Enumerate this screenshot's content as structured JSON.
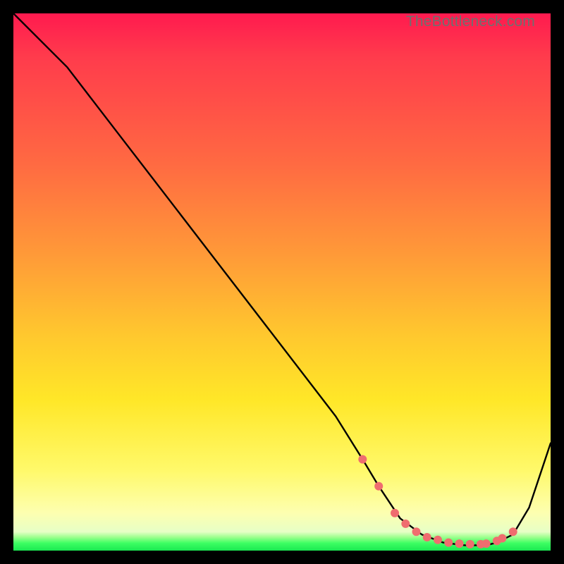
{
  "watermark": "TheBottleneck.com",
  "colors": {
    "frame": "#000000",
    "line": "#000000",
    "marker": "#ef6d6f",
    "gradient_stops": [
      "#ff1a4f",
      "#ff3b4c",
      "#ff6a42",
      "#ff9a38",
      "#ffc82e",
      "#ffe728",
      "#fff96a",
      "#fdffb0",
      "#e7ffc6",
      "#9dff8e",
      "#3dff63",
      "#1ae851"
    ]
  },
  "chart_data": {
    "type": "line",
    "title": "",
    "xlabel": "",
    "ylabel": "",
    "xlim": [
      0,
      100
    ],
    "ylim": [
      0,
      100
    ],
    "grid": false,
    "legend": false,
    "series": [
      {
        "name": "curve",
        "x": [
          0,
          7,
          10,
          20,
          30,
          40,
          50,
          60,
          65,
          68,
          72,
          76,
          80,
          84,
          88,
          90,
          93,
          96,
          100
        ],
        "y": [
          100,
          93,
          90,
          77,
          64,
          51,
          38,
          25,
          17,
          12,
          6,
          3,
          1.5,
          1,
          1,
          1.5,
          3,
          8,
          20
        ]
      }
    ],
    "markers": {
      "name": "highlighted-points",
      "x": [
        65,
        68,
        71,
        73,
        75,
        77,
        79,
        81,
        83,
        85,
        87,
        88,
        90,
        91,
        93
      ],
      "y": [
        17,
        12,
        7,
        5,
        3.5,
        2.5,
        2,
        1.5,
        1.3,
        1.2,
        1.2,
        1.3,
        1.8,
        2.3,
        3.5
      ]
    }
  }
}
